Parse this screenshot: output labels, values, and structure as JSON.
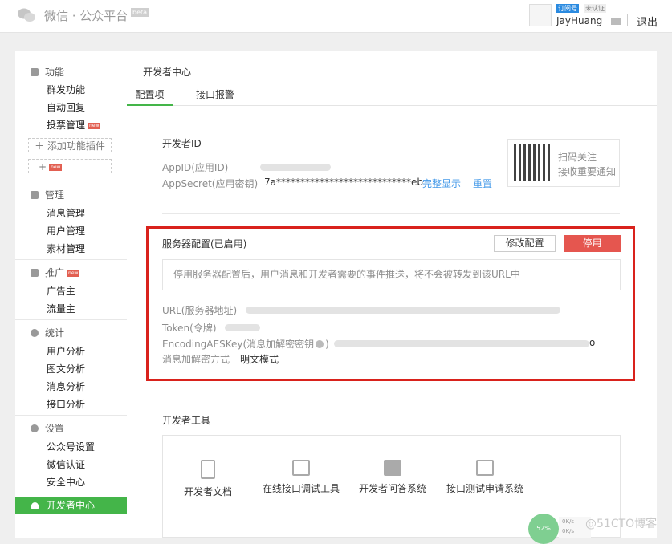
{
  "header": {
    "logo_text": "微信 · 公众平台",
    "beta": "beta",
    "badge_type": "订阅号",
    "badge_cert": "未认证",
    "username": "JayHuang",
    "logout": "退出"
  },
  "sidebar": {
    "groups": [
      {
        "title": "功能",
        "items": [
          "群发功能",
          "自动回复",
          "投票管理"
        ]
      },
      {
        "title": "管理",
        "items": [
          "消息管理",
          "用户管理",
          "素材管理"
        ]
      },
      {
        "title": "推广",
        "items": [
          "广告主",
          "流量主"
        ]
      },
      {
        "title": "统计",
        "items": [
          "用户分析",
          "图文分析",
          "消息分析",
          "接口分析"
        ]
      },
      {
        "title": "设置",
        "items": [
          "公众号设置",
          "微信认证",
          "安全中心"
        ]
      }
    ],
    "add_plugin": "＋ 添加功能插件",
    "plus": "+",
    "new_badge": "new",
    "active_item": "开发者中心"
  },
  "main": {
    "page_title": "开发者中心",
    "tabs": [
      "配置项",
      "接口报警"
    ],
    "developer_id": {
      "title": "开发者ID",
      "appid_label": "AppID(应用ID)",
      "appsecret_label": "AppSecret(应用密钥)",
      "appsecret_value": "7a****************************eb",
      "show_full": "完整显示",
      "reset": "重置"
    },
    "qr": {
      "line1": "扫码关注",
      "line2": "接收重要通知"
    },
    "server": {
      "title": "服务器配置(已启用)",
      "edit_button": "修改配置",
      "stop_button": "停用",
      "notice": "停用服务器配置后，用户消息和开发者需要的事件推送，将不会被转发到该URL中",
      "url_label": "URL(服务器地址)",
      "token_label": "Token(令牌)",
      "aes_label": "EncodingAESKey(消息加解密密钥",
      "aes_label_end": ")",
      "aes_tail": "o",
      "mode_label": "消息加解密方式",
      "mode_value": "明文模式"
    },
    "tools": {
      "title": "开发者工具",
      "items": [
        "开发者文档",
        "在线接口调试工具",
        "开发者问答系统",
        "接口测试申请系统"
      ]
    }
  },
  "overlay": {
    "percent": "52%",
    "up": "0K/s",
    "down": "0K/s",
    "watermark": "@51CTO博客"
  }
}
